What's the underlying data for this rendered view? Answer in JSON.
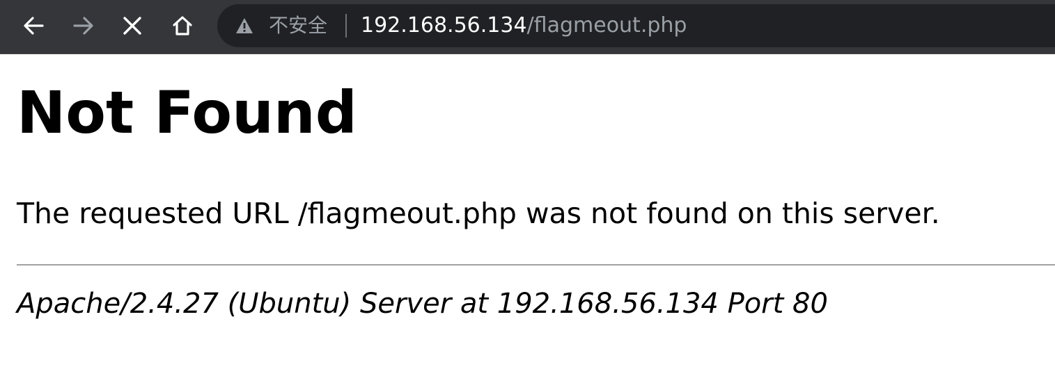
{
  "browser": {
    "security_label": "不安全",
    "url_host": "192.168.56.134",
    "url_path": "/flagmeout.php",
    "buttons": {
      "back_icon": "arrow-left",
      "forward_icon": "arrow-right",
      "stop_icon": "x",
      "home_icon": "house"
    },
    "colors": {
      "toolbar": "#35363a",
      "omnibox": "#202124",
      "icon_active": "#ffffff",
      "icon_disabled": "#9aa0a6"
    }
  },
  "page": {
    "heading": "Not Found",
    "message": "The requested URL /flagmeout.php was not found on this server.",
    "server_signature": "Apache/2.4.27 (Ubuntu) Server at 192.168.56.134 Port 80"
  }
}
